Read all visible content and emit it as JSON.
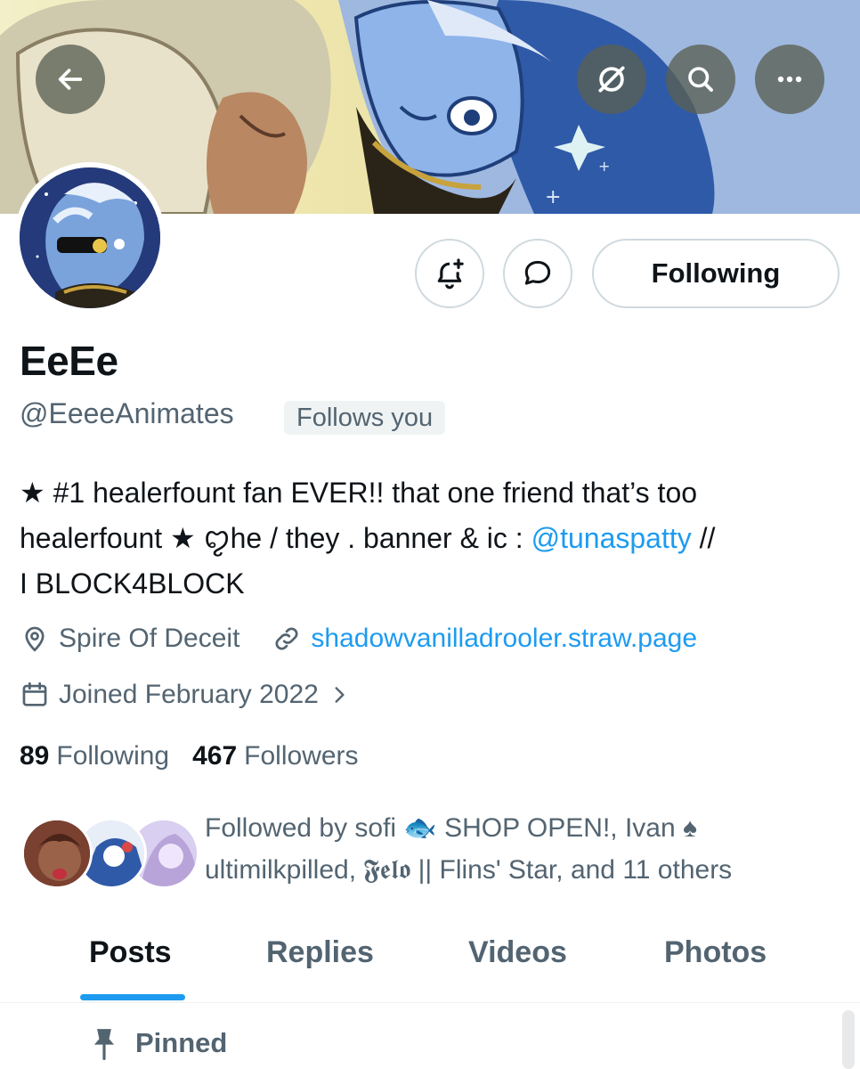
{
  "header": {
    "back_icon": "arrow-left-icon",
    "grok_icon": "grok-icon",
    "search_icon": "search-icon",
    "more_icon": "ellipsis-icon"
  },
  "profile": {
    "display_name": "EeEe",
    "handle": "@EeeeAnimates",
    "follows_you_badge": "Follows you",
    "bio": {
      "line1": "★ #1 healerfount fan EVER!! that one friend that’s too",
      "line2_before": "healerfount ★ ꨄhe / they . banner & ic : ",
      "mention": "@tunaspatty",
      "line2_after": " //",
      "line3": "I BLOCK4BLOCK"
    },
    "location": "Spire Of Deceit",
    "website": "shadowvanilladrooler.straw.page",
    "joined": "Joined February 2022",
    "following_count": "89",
    "following_label": "Following",
    "followers_count": "467",
    "followers_label": "Followers",
    "followed_by": {
      "line1": "Followed by sofi 🐟 SHOP OPEN!, Ivan ♠",
      "line2": "ultimilkpilled, 𝕱𝖊𝖑𝖔 || Flins' Star, and 11 others"
    }
  },
  "actions": {
    "notify_icon": "bell-plus-icon",
    "message_icon": "message-bubble-icon",
    "following_button": "Following"
  },
  "tabs": [
    {
      "label": "Posts",
      "active": true
    },
    {
      "label": "Replies",
      "active": false
    },
    {
      "label": "Videos",
      "active": false
    },
    {
      "label": "Photos",
      "active": false
    }
  ],
  "pinned_label": "Pinned",
  "colors": {
    "accent": "#1d9bf0",
    "text_primary": "#0f1419",
    "text_secondary": "#536471",
    "border": "#cfd9de"
  }
}
